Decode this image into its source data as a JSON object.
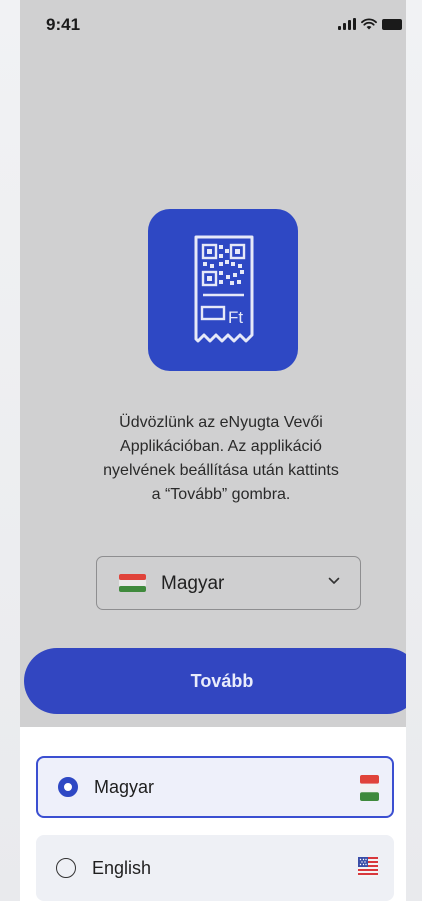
{
  "status_bar": {
    "time": "9:41",
    "icons": [
      "signal-icon",
      "wifi-icon",
      "battery-icon"
    ]
  },
  "logo": {
    "icon": "receipt-qr-icon",
    "currency_text": "Ft",
    "background_color": "#2e48c4"
  },
  "welcome": {
    "line1": "Üdvözlünk az eNyugta Vevői",
    "line2": "Applikációban. Az applikáció",
    "line3": "nyelvének beállítása után kattints",
    "line4": "a “Tovább” gombra."
  },
  "language_select": {
    "selected_value": "Magyar",
    "flag_icon": "hungary-flag-icon",
    "chevron_icon": "chevron-down-icon"
  },
  "next_button": {
    "label": "Tovább",
    "color": "#3246c1"
  },
  "language_options": [
    {
      "label": "Magyar",
      "flag_icon": "hungary-flag-icon",
      "selected": true
    },
    {
      "label": "English",
      "flag_icon": "usa-flag-icon",
      "selected": false
    }
  ],
  "colors": {
    "accent": "#2e48c4",
    "hungary_red": "#e0433a",
    "hungary_green": "#3f8a3c"
  }
}
